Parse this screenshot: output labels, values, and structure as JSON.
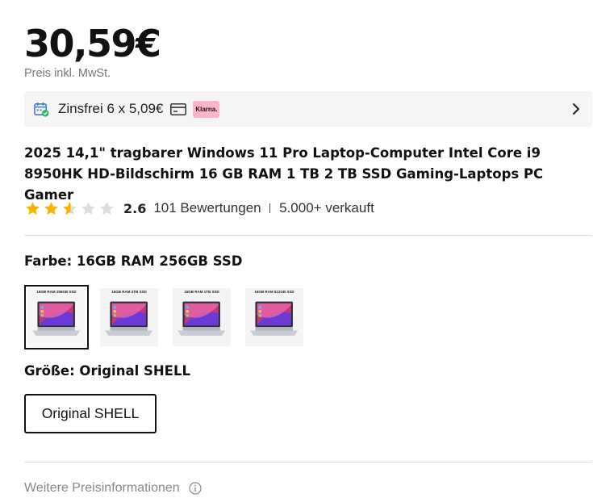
{
  "price": "30,59€",
  "price_note": "Preis inkl. MwSt.",
  "klarna": {
    "text": "Zinsfrei 6 x 5,09€",
    "badge": "Klarna."
  },
  "product_title": "2025 14,1\" tragbarer Windows 11 Pro Laptop-Computer Intel Core i9 8950HK HD-Bildschirm 16 GB RAM 1 TB 2 TB SSD Gaming-Laptops PC Gamer",
  "rating": {
    "value": "2.6",
    "stars": 2.6,
    "reviews": "101 Bewertungen",
    "sold": "5.000+ verkauft"
  },
  "color": {
    "label": "Farbe: 16GB RAM 256GB SSD",
    "options": [
      {
        "caption": "16GB RAM  256GB SSD"
      },
      {
        "caption": "16GB RAM  2TB SSD"
      },
      {
        "caption": "16GB RAM  1TB SSD"
      },
      {
        "caption": "16GB RAM  512GB SSD"
      }
    ]
  },
  "size": {
    "label": "Größe: Original SHELL",
    "option": "Original SHELL"
  },
  "more_info": "Weitere Preisinformationen",
  "colors": {
    "star": "#f6b400",
    "star_empty": "#dddddd",
    "klarna_pink": "#ffb3c7",
    "accent_blue": "#3d7bd9"
  }
}
